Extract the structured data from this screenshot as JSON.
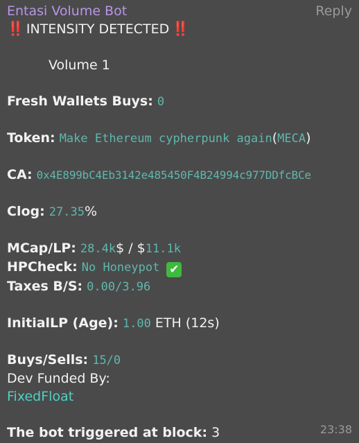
{
  "message": {
    "sender": "Entasi Volume Bot",
    "reply_label": "Reply",
    "alert_icon": "‼️",
    "alert_text": "INTENSITY DETECTED",
    "volume_text": "Volume 1",
    "fresh_wallets_label": "Fresh Wallets Buys:",
    "fresh_wallets_value": "0",
    "token_label": "Token:",
    "token_name": "Make Ethereum cypherpunk again",
    "token_open": "(",
    "token_symbol": "MECA",
    "token_close": ")",
    "ca_label": "CA:",
    "ca_value": "0x4E899bC4Eb3142e485450F4B24994c977DDfcBCe",
    "clog_label": "Clog:",
    "clog_value": "27.35",
    "clog_unit": "%",
    "mcap_label": "MCap/LP:",
    "mcap_value": "28.4k",
    "mcap_sep": "$ / $",
    "lp_value": "11.1k",
    "hpcheck_label": "HPCheck:",
    "hpcheck_value": "No Honeypot",
    "check_icon": "✔",
    "taxes_label": "Taxes B/S:",
    "taxes_value": "0.00/3.96",
    "initial_lp_label": "InitialLP (Age):",
    "initial_lp_value": "1.00",
    "initial_lp_unit": "ETH",
    "initial_lp_age": "(12s)",
    "buys_sells_label": "Buys/Sells:",
    "buys_sells_value": "15/0",
    "dev_funded_label": "Dev Funded By:",
    "dev_funded_value": "FixedFloat",
    "trigger_label": "The bot triggered at block:",
    "trigger_value": "3",
    "timestamp": "23:38"
  },
  "colors": {
    "background": "#4a4a4a",
    "sender": "#b895e6",
    "mono": "#5fb8ae",
    "link": "#4fd1c5",
    "alert": "#e23a3a",
    "check": "#3fb93f"
  }
}
